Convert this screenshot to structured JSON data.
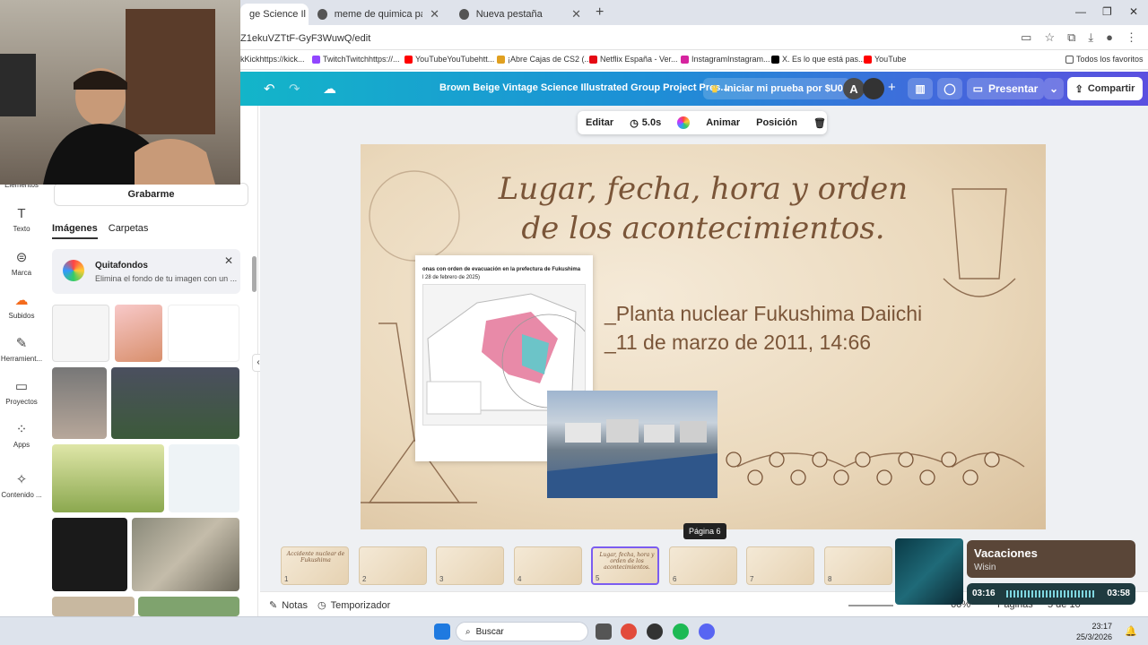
{
  "browser": {
    "tabs": [
      {
        "label": "ge Science Il",
        "active": true
      },
      {
        "label": "meme de quimica para termina"
      },
      {
        "label": "Nueva pestaña"
      }
    ],
    "url": "Z1ekuVZTtF-GyF3WuwQ/edit",
    "bookmarks": [
      {
        "label": "kKickhttps://kick..."
      },
      {
        "label": "TwitchTwitchhttps://..."
      },
      {
        "label": "YouTubeYouTubehtt..."
      },
      {
        "label": "¡Abre Cajas de CS2 (..."
      },
      {
        "label": "Netflix España - Ver..."
      },
      {
        "label": "InstagramInstagram..."
      },
      {
        "label": "X. Es lo que está pas..."
      },
      {
        "label": "YouTube"
      }
    ],
    "all_favorites": "Todos los favoritos"
  },
  "canva": {
    "doc_title": "Brown Beige Vintage Science Illustrated Group Project Pres...",
    "trial_label": "Iniciar mi prueba por $U0",
    "avatar_letter": "A",
    "present_label": "Presentar",
    "share_label": "Compartir"
  },
  "rail": {
    "items": [
      {
        "label": "Elementos"
      },
      {
        "label": "Texto"
      },
      {
        "label": "Marca"
      },
      {
        "label": "Subidos"
      },
      {
        "label": "Herramient..."
      },
      {
        "label": "Proyectos"
      },
      {
        "label": "Apps"
      },
      {
        "label": "Contenido ..."
      }
    ]
  },
  "panel": {
    "record_label": "Grabarme",
    "tabs": [
      {
        "label": "Imágenes",
        "active": true
      },
      {
        "label": "Carpetas"
      }
    ],
    "quitafondos": {
      "title": "Quitafondos",
      "description": "Elimina el fondo de tu imagen con un ..."
    }
  },
  "toolbar": {
    "edit_label": "Editar",
    "duration": "5.0s",
    "animate_label": "Animar",
    "position_label": "Posición"
  },
  "slide": {
    "title_line1": "Lugar, fecha, hora y orden",
    "title_line2": "de los acontecimientos.",
    "line1": "_Planta nuclear Fukushima Daiichi",
    "line2": "_11 de marzo de 2011, 14:66",
    "map_title": "onas con orden de evacuación en la prefectura de Fukushima",
    "map_date": "l 28 de febrero de 2025)"
  },
  "page_tooltip": "Página 6",
  "filmstrip": [
    {
      "num": "1",
      "caption": "Accidente nuclear de Fukushima"
    },
    {
      "num": "2",
      "caption": ""
    },
    {
      "num": "3",
      "caption": ""
    },
    {
      "num": "4",
      "caption": ""
    },
    {
      "num": "5",
      "caption": "Lugar, fecha, hora y orden de los acontecimientos.",
      "selected": true
    },
    {
      "num": "6",
      "caption": ""
    },
    {
      "num": "7",
      "caption": ""
    },
    {
      "num": "8",
      "caption": ""
    }
  ],
  "footer": {
    "notes_label": "Notas",
    "timer_label": "Temporizador",
    "zoom": "60%",
    "pages_label": "Páginas",
    "page_count": "5 de 10"
  },
  "music": {
    "title": "Vacaciones",
    "artist": "Wisin",
    "elapsed": "03:16",
    "total": "03:58"
  },
  "taskbar": {
    "search_placeholder": "Buscar",
    "time": "23:17",
    "date": "25/3/2026"
  },
  "colors": {
    "canva_gradient_start": "#13b5c9",
    "canva_gradient_end": "#5b4fe0",
    "slide_text": "#7a5538",
    "selected_thumb": "#7b5cf0"
  }
}
